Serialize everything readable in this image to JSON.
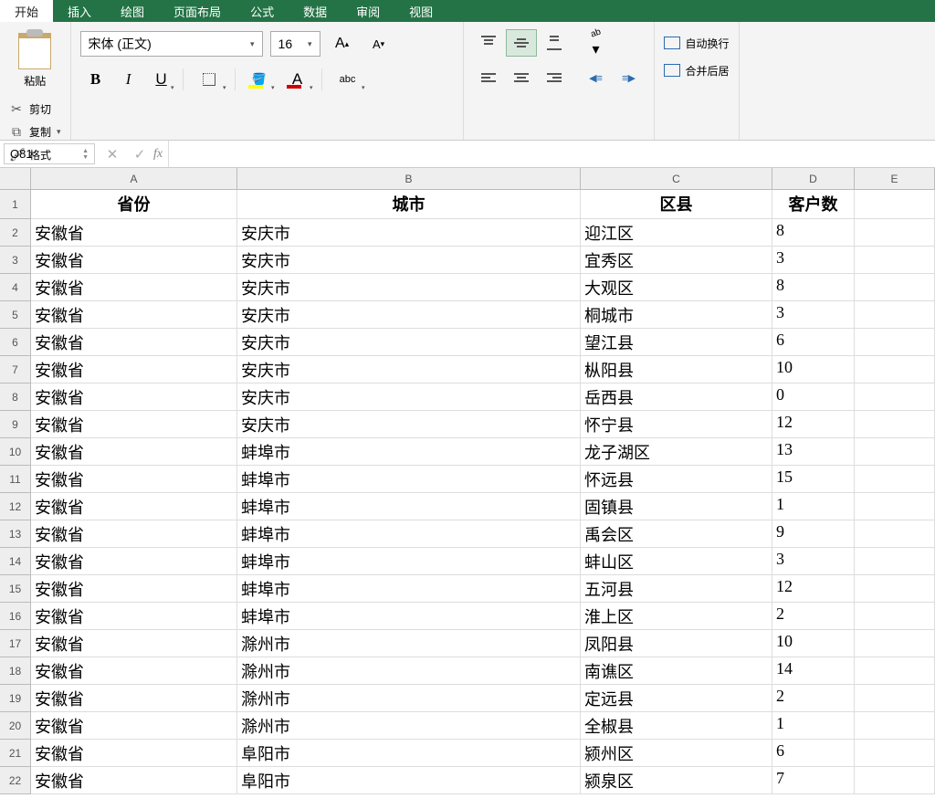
{
  "tabs": {
    "home": "开始",
    "insert": "插入",
    "draw": "绘图",
    "layout": "页面布局",
    "formula": "公式",
    "data": "数据",
    "review": "审阅",
    "view": "视图"
  },
  "clipboard": {
    "paste": "粘贴",
    "cut": "剪切",
    "copy": "复制",
    "format": "格式"
  },
  "font": {
    "name": "宋体 (正文)",
    "size": "16",
    "increase": "A",
    "decrease": "A",
    "bold": "B",
    "italic": "I",
    "underline": "U",
    "fontcolor": "A",
    "ruby": "abc"
  },
  "merge": {
    "wrap": "自动换行",
    "merge": "合并后居"
  },
  "namebox": "O81",
  "fx": "fx",
  "columns": [
    "A",
    "B",
    "C",
    "D",
    "E"
  ],
  "headers": {
    "province": "省份",
    "city": "城市",
    "district": "区县",
    "customers": "客户数"
  },
  "rows": [
    {
      "n": 2,
      "p": "安徽省",
      "c": "安庆市",
      "d": "迎江区",
      "v": "8"
    },
    {
      "n": 3,
      "p": "安徽省",
      "c": "安庆市",
      "d": "宜秀区",
      "v": "3"
    },
    {
      "n": 4,
      "p": "安徽省",
      "c": "安庆市",
      "d": "大观区",
      "v": "8"
    },
    {
      "n": 5,
      "p": "安徽省",
      "c": "安庆市",
      "d": "桐城市",
      "v": "3"
    },
    {
      "n": 6,
      "p": "安徽省",
      "c": "安庆市",
      "d": "望江县",
      "v": "6"
    },
    {
      "n": 7,
      "p": "安徽省",
      "c": "安庆市",
      "d": "枞阳县",
      "v": "10"
    },
    {
      "n": 8,
      "p": "安徽省",
      "c": "安庆市",
      "d": "岳西县",
      "v": "0"
    },
    {
      "n": 9,
      "p": "安徽省",
      "c": "安庆市",
      "d": "怀宁县",
      "v": "12"
    },
    {
      "n": 10,
      "p": "安徽省",
      "c": "蚌埠市",
      "d": "龙子湖区",
      "v": "13"
    },
    {
      "n": 11,
      "p": "安徽省",
      "c": "蚌埠市",
      "d": "怀远县",
      "v": "15"
    },
    {
      "n": 12,
      "p": "安徽省",
      "c": "蚌埠市",
      "d": "固镇县",
      "v": "1"
    },
    {
      "n": 13,
      "p": "安徽省",
      "c": "蚌埠市",
      "d": "禹会区",
      "v": "9"
    },
    {
      "n": 14,
      "p": "安徽省",
      "c": "蚌埠市",
      "d": "蚌山区",
      "v": "3"
    },
    {
      "n": 15,
      "p": "安徽省",
      "c": "蚌埠市",
      "d": "五河县",
      "v": "12"
    },
    {
      "n": 16,
      "p": "安徽省",
      "c": "蚌埠市",
      "d": "淮上区",
      "v": "2"
    },
    {
      "n": 17,
      "p": "安徽省",
      "c": "滁州市",
      "d": "凤阳县",
      "v": "10"
    },
    {
      "n": 18,
      "p": "安徽省",
      "c": "滁州市",
      "d": "南谯区",
      "v": "14"
    },
    {
      "n": 19,
      "p": "安徽省",
      "c": "滁州市",
      "d": "定远县",
      "v": "2"
    },
    {
      "n": 20,
      "p": "安徽省",
      "c": "滁州市",
      "d": "全椒县",
      "v": "1"
    },
    {
      "n": 21,
      "p": "安徽省",
      "c": "阜阳市",
      "d": "颍州区",
      "v": "6"
    },
    {
      "n": 22,
      "p": "安徽省",
      "c": "阜阳市",
      "d": "颍泉区",
      "v": "7"
    }
  ]
}
